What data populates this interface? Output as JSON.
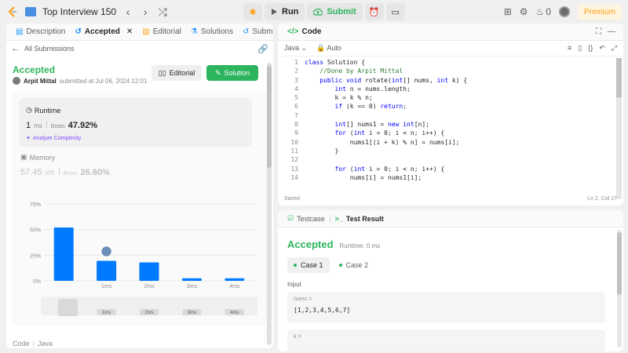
{
  "topbar": {
    "title": "Top Interview 150",
    "run_label": "Run",
    "submit_label": "Submit",
    "streak_count": "0",
    "premium_label": "Premium"
  },
  "left": {
    "tabs": [
      "Description",
      "Accepted",
      "Editorial",
      "Solutions",
      "Submissions"
    ],
    "back_label": "All Submissions",
    "status": "Accepted",
    "author": "Arpit Mittal",
    "submitted_text": "submitted at Jul 06, 2024 12:01",
    "editorial_btn": "Editorial",
    "solution_btn": "Solution",
    "runtime": {
      "label": "Runtime",
      "value": "1",
      "unit": "ms",
      "beats_label": "Beats",
      "beats": "47.92%",
      "analyze": "Analyze Complexity"
    },
    "memory": {
      "label": "Memory",
      "value": "57.45",
      "unit": "MB",
      "beats_label": "Beats",
      "beats": "26.60%"
    },
    "code_label": "Code",
    "lang_label": "Java"
  },
  "chart_data": {
    "type": "bar",
    "categories": [
      "0ms",
      "1ms",
      "2ms",
      "3ms",
      "4ms"
    ],
    "x_tick_labels": [
      "",
      "1ms",
      "2ms",
      "3ms",
      "4ms"
    ],
    "values": [
      52,
      19.5,
      18,
      2.5,
      2.5
    ],
    "ylim": [
      0,
      75
    ],
    "yticks": [
      "0%",
      "25%",
      "50%",
      "75%"
    ],
    "highlight_category": "1ms",
    "bar_color": "#007aff",
    "selector_labels": [
      "1ms",
      "2ms",
      "3ms",
      "4ms"
    ]
  },
  "editor": {
    "title": "Code",
    "language": "Java",
    "auto_label": "Auto",
    "saved_label": "Saved",
    "cursor": "Ln 2, Col 27",
    "lines": [
      {
        "n": "1",
        "html": "<span class=\"kw\">class</span> Solution {"
      },
      {
        "n": "2",
        "html": "    <span class=\"cm\">//Done by Arpit Mittal</span>"
      },
      {
        "n": "3",
        "html": "    <span class=\"kw\">public void</span> rotate(<span class=\"kw\">int</span>[] nums, <span class=\"kw\">int</span> k) {"
      },
      {
        "n": "4",
        "html": "        <span class=\"kw\">int</span> n = nums.length;"
      },
      {
        "n": "5",
        "html": "        k = k % n;"
      },
      {
        "n": "6",
        "html": "        <span class=\"kw\">if</span> (k == 0) <span class=\"kw\">return</span>;"
      },
      {
        "n": "7",
        "html": ""
      },
      {
        "n": "8",
        "html": "        <span class=\"kw\">int</span>[] nums1 = <span class=\"kw\">new int</span>[n];"
      },
      {
        "n": "9",
        "html": "        <span class=\"kw\">for</span> (<span class=\"kw\">int</span> i = 0; i &lt; n; i++) {"
      },
      {
        "n": "10",
        "html": "            nums1[(i + k) % n] = nums[i];"
      },
      {
        "n": "11",
        "html": "        }"
      },
      {
        "n": "12",
        "html": ""
      },
      {
        "n": "13",
        "html": "        <span class=\"kw\">for</span> (<span class=\"kw\">int</span> i = 0; i &lt; n; i++) {"
      },
      {
        "n": "14",
        "html": "            nums[i] = nums1[i];"
      }
    ]
  },
  "result": {
    "tab_testcase": "Testcase",
    "tab_result": "Test Result",
    "status": "Accepted",
    "runtime": "Runtime: 0 ms",
    "cases": [
      "Case 1",
      "Case 2"
    ],
    "input_label": "Input",
    "nums_key": "nums =",
    "nums_val": "[1,2,3,4,5,6,7]",
    "k_key": "k ="
  }
}
